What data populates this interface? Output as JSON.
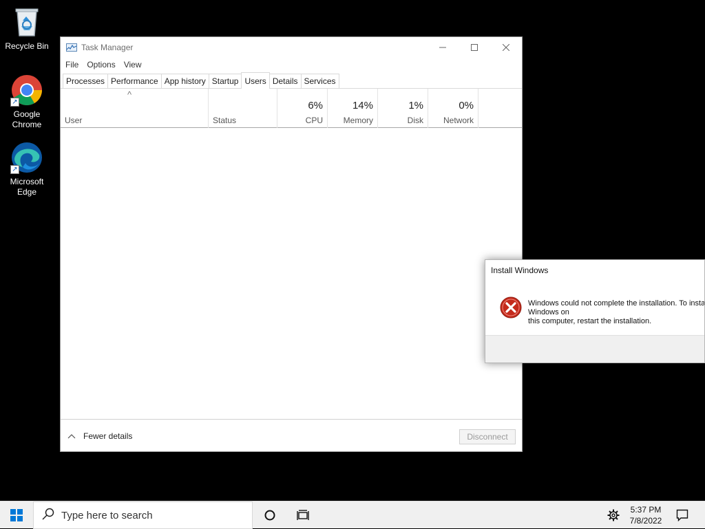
{
  "desktop": {
    "icons": [
      {
        "label": "Recycle Bin"
      },
      {
        "label": "Google\nChrome"
      },
      {
        "label": "Microsoft\nEdge"
      }
    ]
  },
  "task_manager": {
    "title": "Task Manager",
    "menu": [
      "File",
      "Options",
      "View"
    ],
    "tabs": [
      "Processes",
      "Performance",
      "App history",
      "Startup",
      "Users",
      "Details",
      "Services"
    ],
    "active_tab": "Users",
    "columns": {
      "user": "User",
      "status": "Status",
      "cpu": {
        "label": "CPU",
        "value": "6%"
      },
      "memory": {
        "label": "Memory",
        "value": "14%"
      },
      "disk": {
        "label": "Disk",
        "value": "1%"
      },
      "network": {
        "label": "Network",
        "value": "0%"
      }
    },
    "footer": {
      "fewer_details": "Fewer details",
      "disconnect": "Disconnect"
    }
  },
  "install_dialog": {
    "title": "Install Windows",
    "message": "Windows could not complete the installation. To install Windows on\nthis computer, restart the installation."
  },
  "taskbar": {
    "search_placeholder": "Type here to search",
    "time": "5:37 PM",
    "date": "7/8/2022"
  },
  "colors": {
    "desktop_bg": "#000000",
    "error_red": "#c42b1c",
    "taskbar_bg": "#f0f0f0",
    "windows_blue": "#0078d7"
  }
}
